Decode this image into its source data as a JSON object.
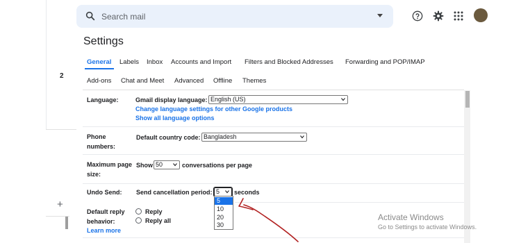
{
  "search": {
    "placeholder": "Search mail"
  },
  "sidebar": {
    "count": "2",
    "compose_plus": "+"
  },
  "settings": {
    "title": "Settings",
    "tabs": [
      {
        "label": "General",
        "active": true
      },
      {
        "label": "Labels"
      },
      {
        "label": "Inbox"
      },
      {
        "label": "Accounts and Import"
      },
      {
        "label": "Filters and Blocked Addresses"
      },
      {
        "label": "Forwarding and POP/IMAP"
      },
      {
        "label": "Add-ons"
      },
      {
        "label": "Chat and Meet"
      },
      {
        "label": "Advanced"
      },
      {
        "label": "Offline"
      },
      {
        "label": "Themes"
      }
    ],
    "language": {
      "label": "Language:",
      "field_label": "Gmail display language:",
      "value": "English (US)",
      "change_link": "Change language settings for other Google products",
      "show_all_link": "Show all language options"
    },
    "phone": {
      "label_line1": "Phone",
      "label_line2": "numbers:",
      "field_label": "Default country code:",
      "value": "Bangladesh"
    },
    "page_size": {
      "label_line1": "Maximum page",
      "label_line2": "size:",
      "prefix": "Show",
      "value": "50",
      "suffix": "conversations per page"
    },
    "undo_send": {
      "label": "Undo Send:",
      "field_label": "Send cancellation period:",
      "value": "5",
      "suffix": "seconds",
      "options": [
        "5",
        "10",
        "20",
        "30"
      ],
      "selected_option": "5"
    },
    "reply": {
      "label_line1": "Default reply",
      "label_line2": "behavior:",
      "option_reply": "Reply",
      "option_reply_all": "Reply all",
      "learn_more": "Learn more"
    }
  },
  "watermark": {
    "title": "Activate Windows",
    "subtitle": "Go to Settings to activate Windows."
  },
  "colors": {
    "accent": "#1a73e8",
    "search_bg": "#eaf1fb",
    "annotation": "#b22222"
  }
}
